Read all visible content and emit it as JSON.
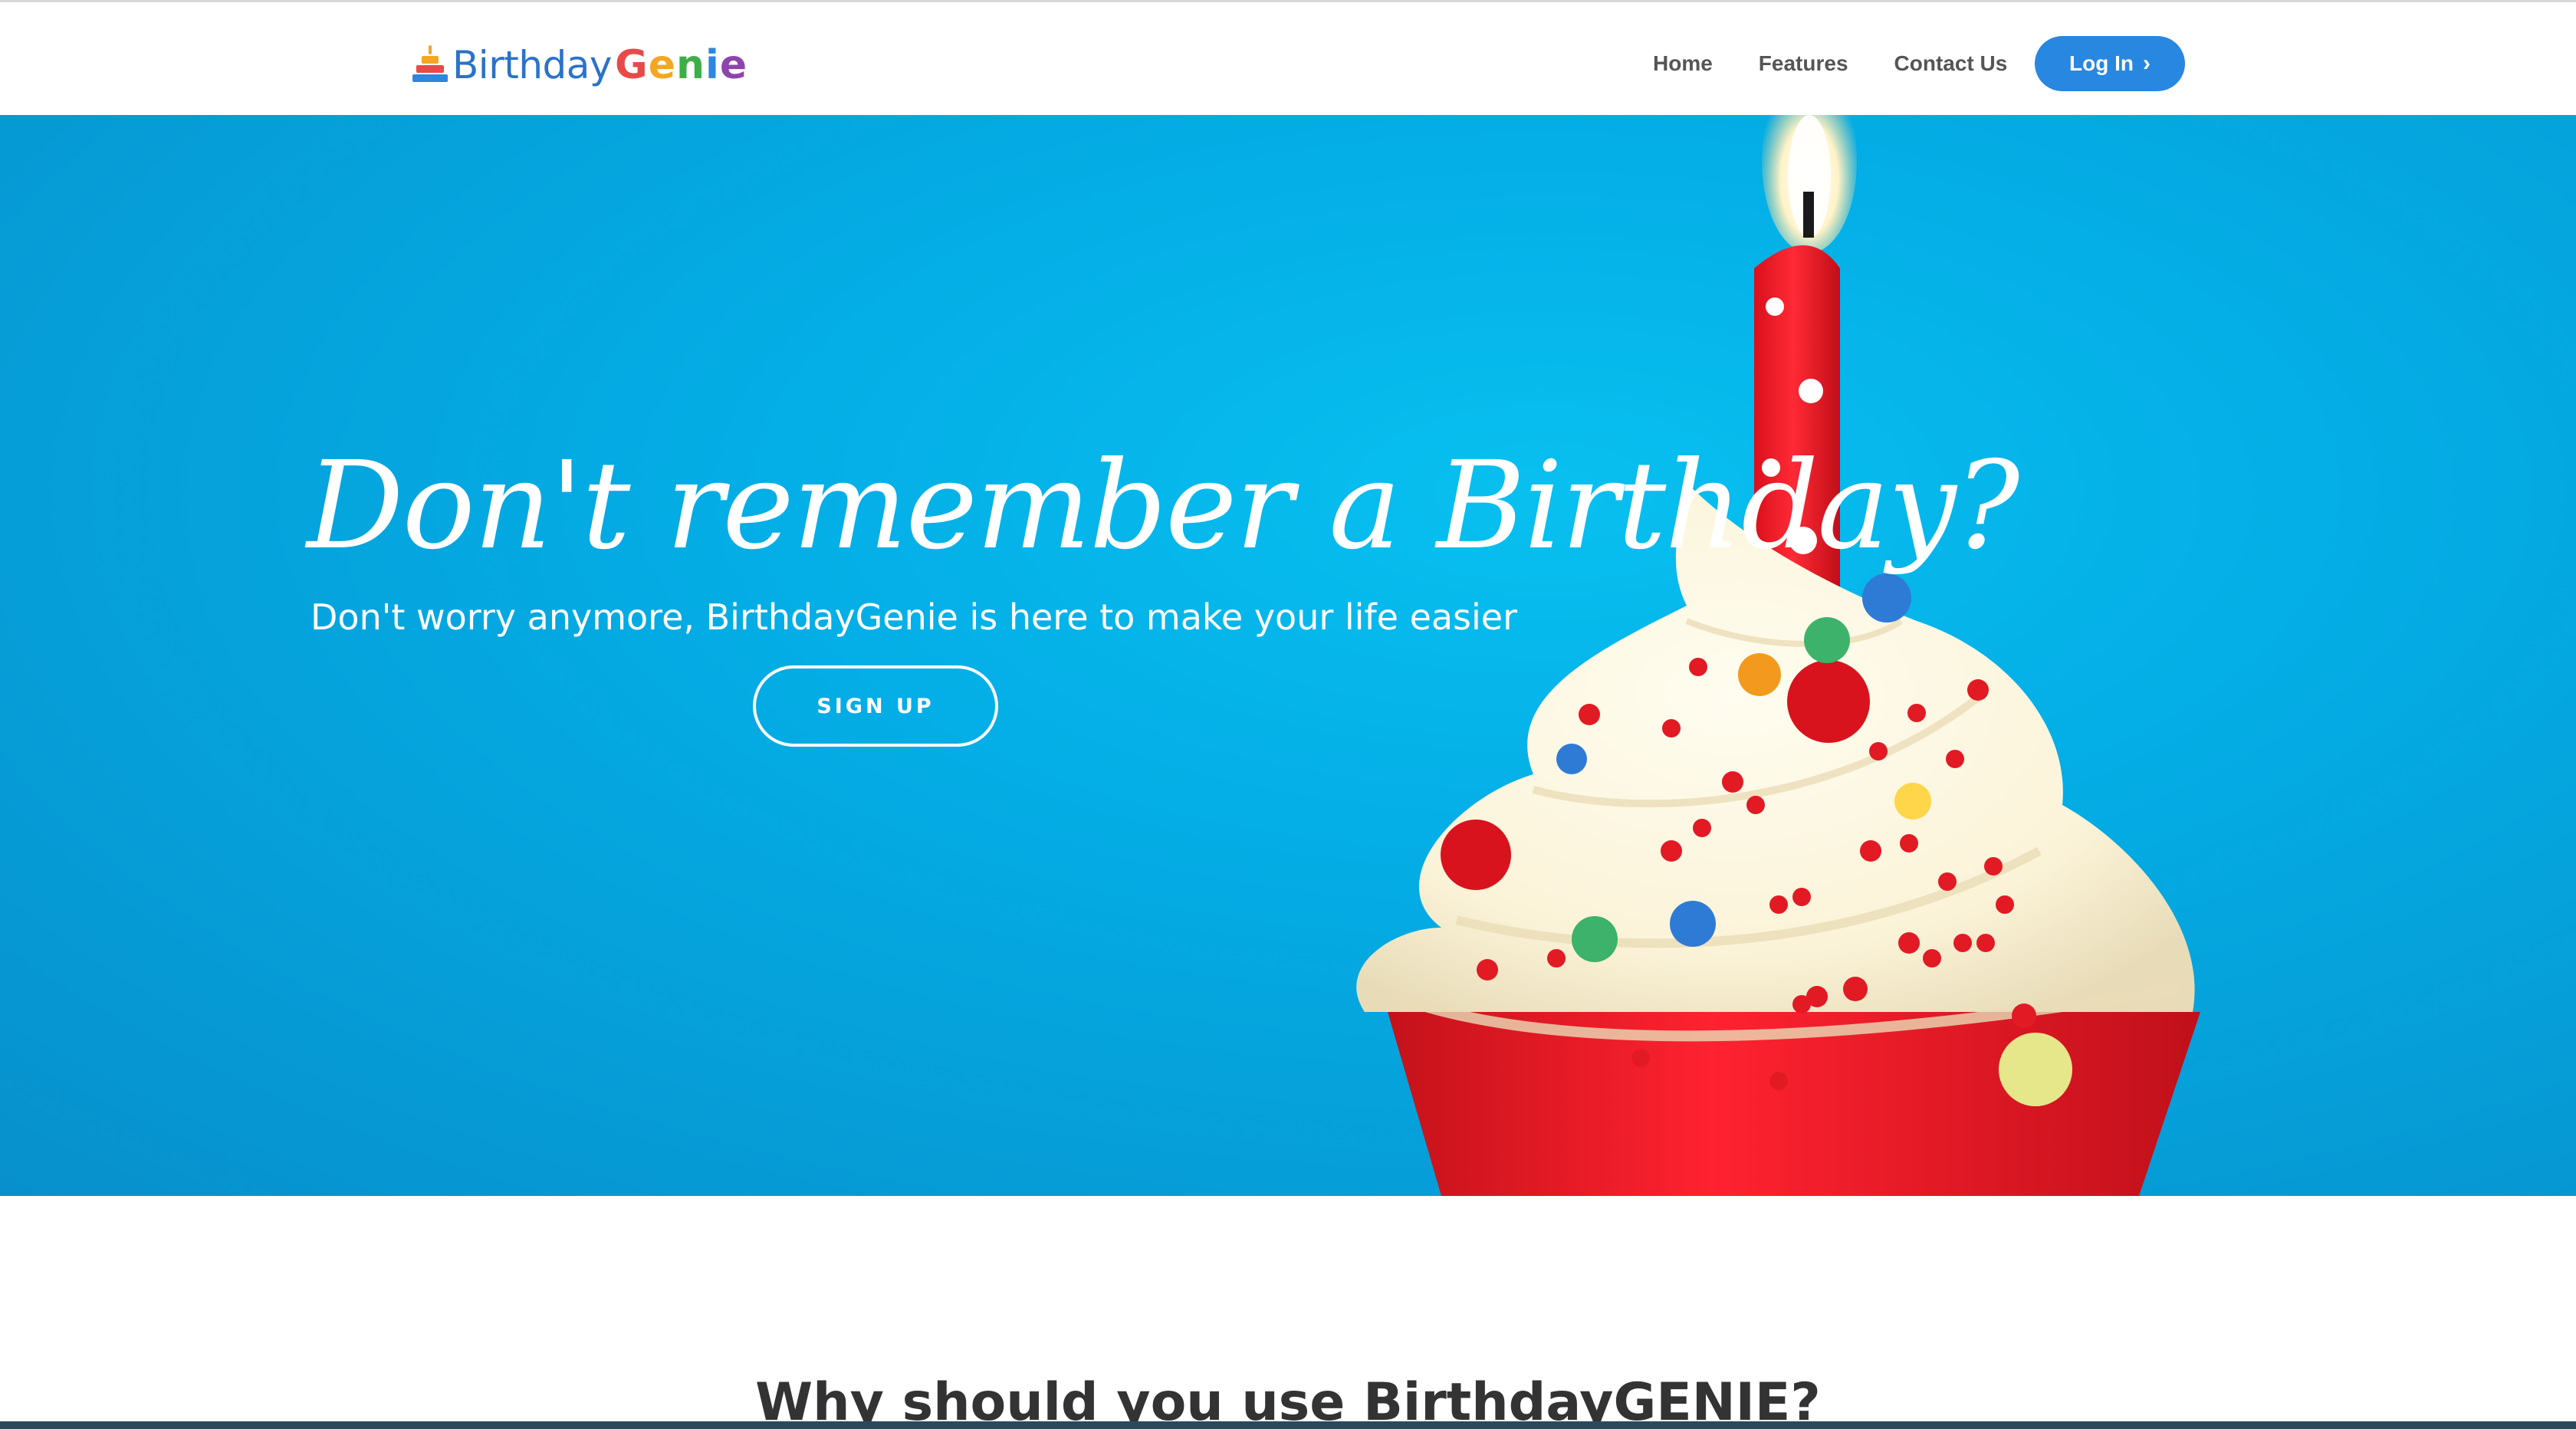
{
  "nav": {
    "logo": {
      "prefix": "Birthday",
      "suffix_letters": [
        "G",
        "e",
        "n",
        "i",
        "e"
      ]
    },
    "links": [
      {
        "label": "Home"
      },
      {
        "label": "Features"
      },
      {
        "label": "Contact Us"
      }
    ],
    "login": {
      "label": "Log In",
      "icon": "chevron-right-icon"
    }
  },
  "hero": {
    "title": "Don't remember a Birthday?",
    "subtitle": "Don't worry anymore, BirthdayGenie is here to make your life easier",
    "cta_label": "SIGN UP",
    "image": "cupcake-with-candle"
  },
  "section": {
    "title": "Why should you use BirthdayGENIE?"
  },
  "colors": {
    "accent": "#2887e0",
    "hero_bg": "#04aee6",
    "logo_genie": [
      "#e84a4a",
      "#f5a623",
      "#3fae49",
      "#2e86de",
      "#8e44ad"
    ]
  }
}
